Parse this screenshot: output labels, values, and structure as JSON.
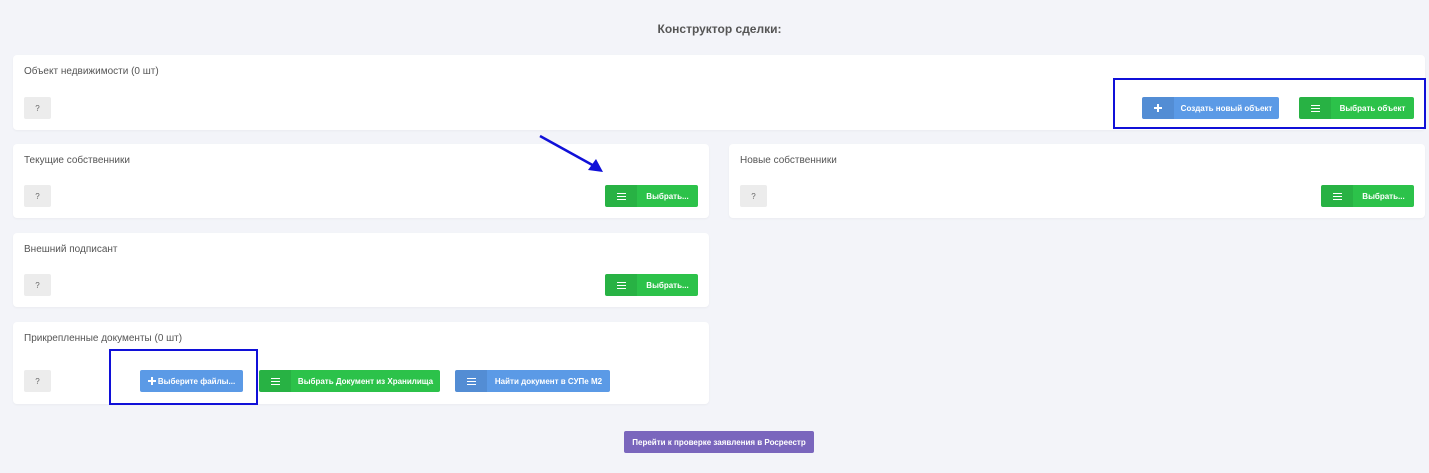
{
  "page": {
    "title": "Конструктор сделки:"
  },
  "help_label": "?",
  "property_card": {
    "title": "Объект недвижимости (0 шт)",
    "create_label": "Создать новый объект",
    "select_label": "Выбрать объект"
  },
  "current_owners_card": {
    "title": "Текущие собственники",
    "select_label": "Выбрать..."
  },
  "new_owners_card": {
    "title": "Новые собственники",
    "select_label": "Выбрать..."
  },
  "external_signer_card": {
    "title": "Внешний подписант",
    "select_label": "Выбрать..."
  },
  "documents_card": {
    "title": "Прикрепленные документы (0 шт)",
    "upload_label": "Выберите файлы...",
    "from_storage_label": "Выбрать Документ из Хранилища",
    "find_label": "Найти документ в СУПе М2"
  },
  "submit_label": "Перейти к проверке заявления в Росреестр",
  "colors": {
    "green": "#2cc24a",
    "blue": "#5b9ae6",
    "purple": "#7a66bd",
    "annotation": "#1010d8"
  },
  "icons": [
    "list-icon",
    "plus-icon",
    "arrow-annotation"
  ]
}
